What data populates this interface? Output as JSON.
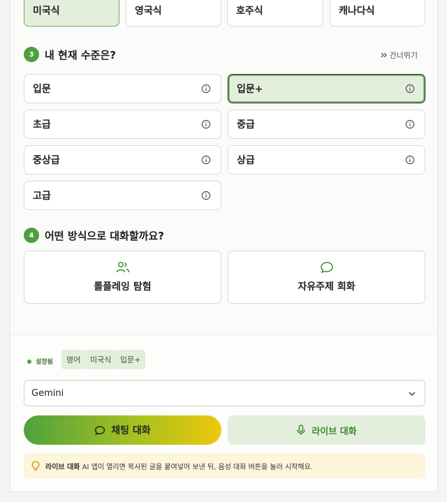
{
  "accent": {
    "options": [
      "미국식",
      "영국식",
      "호주식",
      "캐나다식"
    ],
    "selected": "미국식"
  },
  "level": {
    "step": "3",
    "title": "내 현재 수준은?",
    "skip_label": "건너뛰기",
    "options": [
      "입문",
      "입문+",
      "초급",
      "중급",
      "중상급",
      "상급",
      "고급"
    ],
    "selected": "입문+"
  },
  "mode": {
    "step": "4",
    "title": "어떤 방식으로 대화할까요?",
    "options": [
      {
        "label": "롤플레잉 탐험",
        "icon": "users-icon"
      },
      {
        "label": "자유주제 회화",
        "icon": "chat-bubble-icon"
      }
    ]
  },
  "summary": {
    "status_label": "설정됨",
    "chips": [
      "영어",
      "미국식",
      "입문+"
    ]
  },
  "model_select": {
    "value": "Gemini"
  },
  "actions": {
    "chat_label": "채팅 대화",
    "live_label": "라이브 대화"
  },
  "notice": {
    "bold": "라이브 대화",
    "text": " AI 앱이 열리면 복사된 글을 붙여넣어 보낸 뒤, 음성 대화 버튼을 눌러 시작해요."
  },
  "colors": {
    "brand_green": "#4f9e3f",
    "selected_bg": "#e3efdc",
    "notice_bg": "#fdf5dc"
  }
}
